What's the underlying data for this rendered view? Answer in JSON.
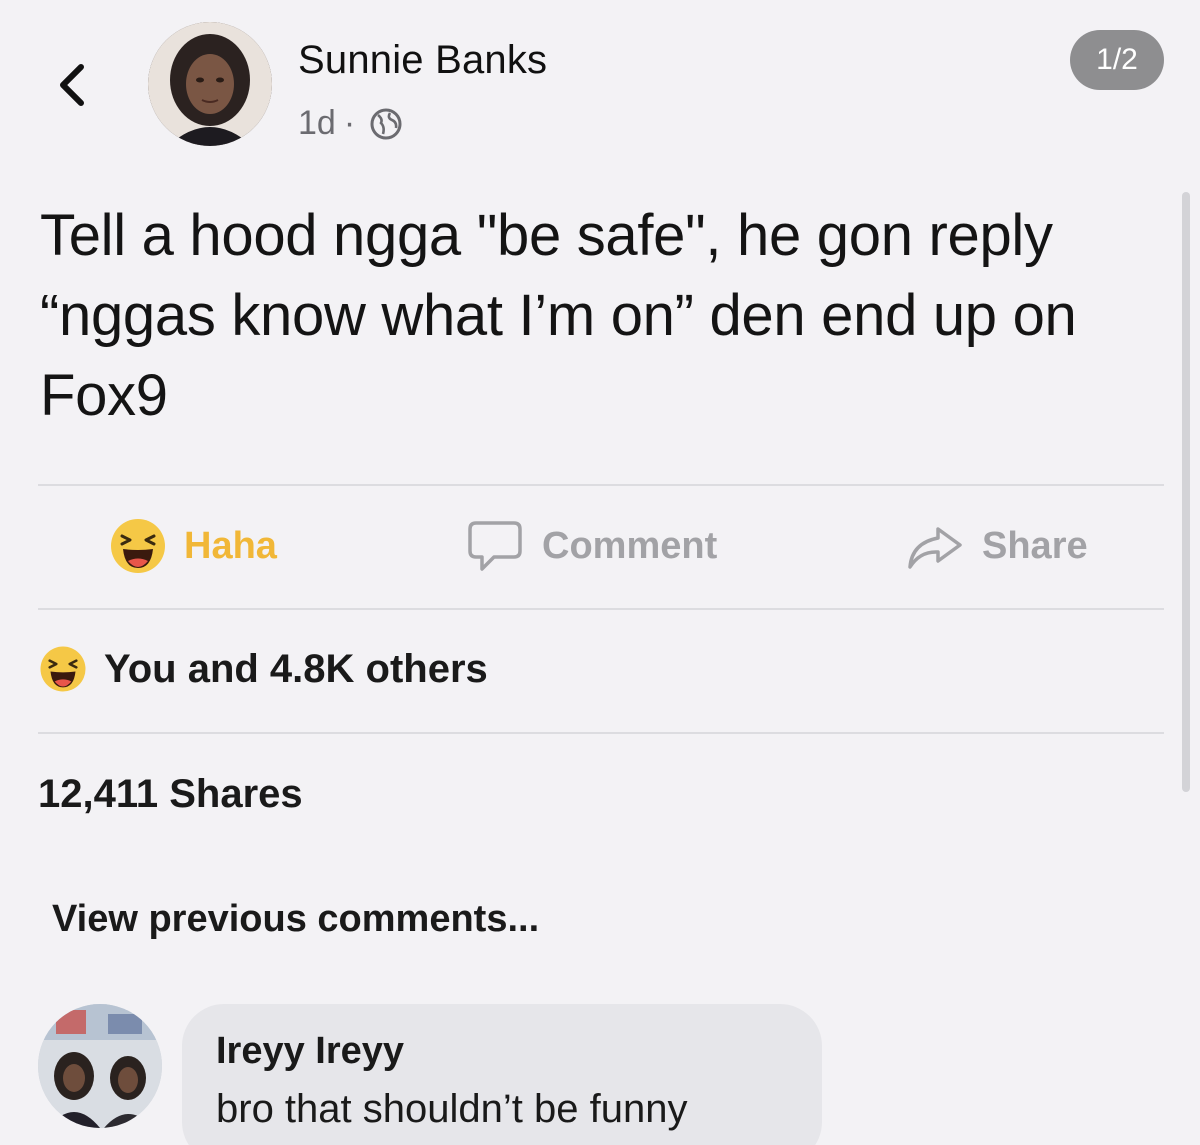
{
  "post": {
    "author_name": "Sunnie Banks",
    "time": "1d",
    "separator": "·",
    "privacy_icon": "globe-icon",
    "page_counter": "1/2",
    "text": "Tell a hood ngga \"be safe\", he gon reply “nggas know what I’m on” den end up on Fox9"
  },
  "actions": {
    "reaction_label": "Haha",
    "reaction_icon": "haha-emoji-icon",
    "comment_label": "Comment",
    "comment_icon": "comment-bubble-icon",
    "share_label": "Share",
    "share_icon": "share-arrow-icon"
  },
  "stats": {
    "reactions_text": "You and 4.8K others",
    "shares_text": "12,411 Shares"
  },
  "comments": {
    "view_previous": "View previous comments...",
    "items": [
      {
        "author": "Ireyy Ireyy",
        "text": "bro that shouldn’t be funny"
      }
    ]
  },
  "colors": {
    "background": "#f3f2f5",
    "haha_accent": "#f1b737",
    "muted_text": "#a2a2a6",
    "counter_bg": "#8e8e90"
  }
}
